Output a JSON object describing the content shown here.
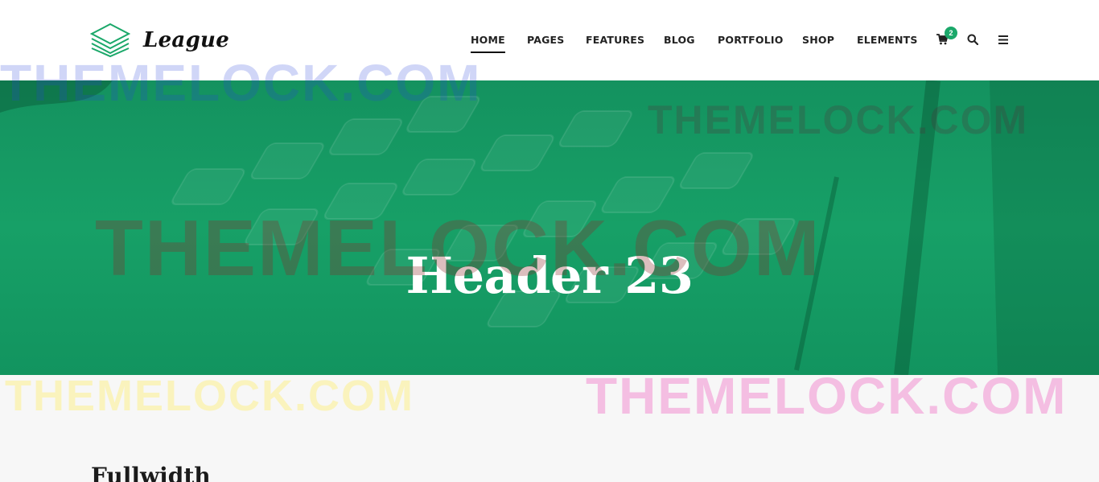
{
  "brand": {
    "name": "League",
    "accent": "#1ba86a"
  },
  "nav": {
    "items": [
      {
        "label": "HOME",
        "active": true
      },
      {
        "label": "PAGES"
      },
      {
        "label": "FEATURES"
      },
      {
        "label": "BLOG"
      },
      {
        "label": "PORTFOLIO"
      },
      {
        "label": "SHOP"
      },
      {
        "label": "ELEMENTS"
      }
    ],
    "cart_count": "2",
    "icons": [
      "cart-icon",
      "search-icon",
      "menu-icon"
    ]
  },
  "hero": {
    "title": "Header 23",
    "overlay_color": "#14925f"
  },
  "content": {
    "section_title": "Fullwidth"
  },
  "watermarks": [
    "THEMELOCK.COM",
    "THEMELOCK.COM",
    "THEMELOCK.COM",
    "THEMELOCK.COM",
    "THEMELOCK.COM"
  ]
}
